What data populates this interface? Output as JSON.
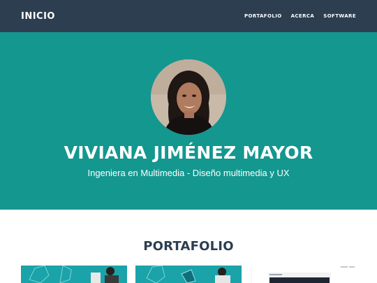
{
  "navbar": {
    "brand": "INICIO",
    "links": [
      "PORTAFOLIO",
      "ACERCA",
      "SOFTWARE"
    ]
  },
  "masthead": {
    "heading": "VIVIANA JIMÉNEZ MAYOR",
    "subheading": "Ingeniera en Multimedia - Diseño multimedia y UX"
  },
  "portfolio": {
    "title": "PORTAFOLIO"
  },
  "colors": {
    "navbar": "#2c3e50",
    "masthead": "#13978f",
    "heading_dark": "#2c3e50"
  }
}
